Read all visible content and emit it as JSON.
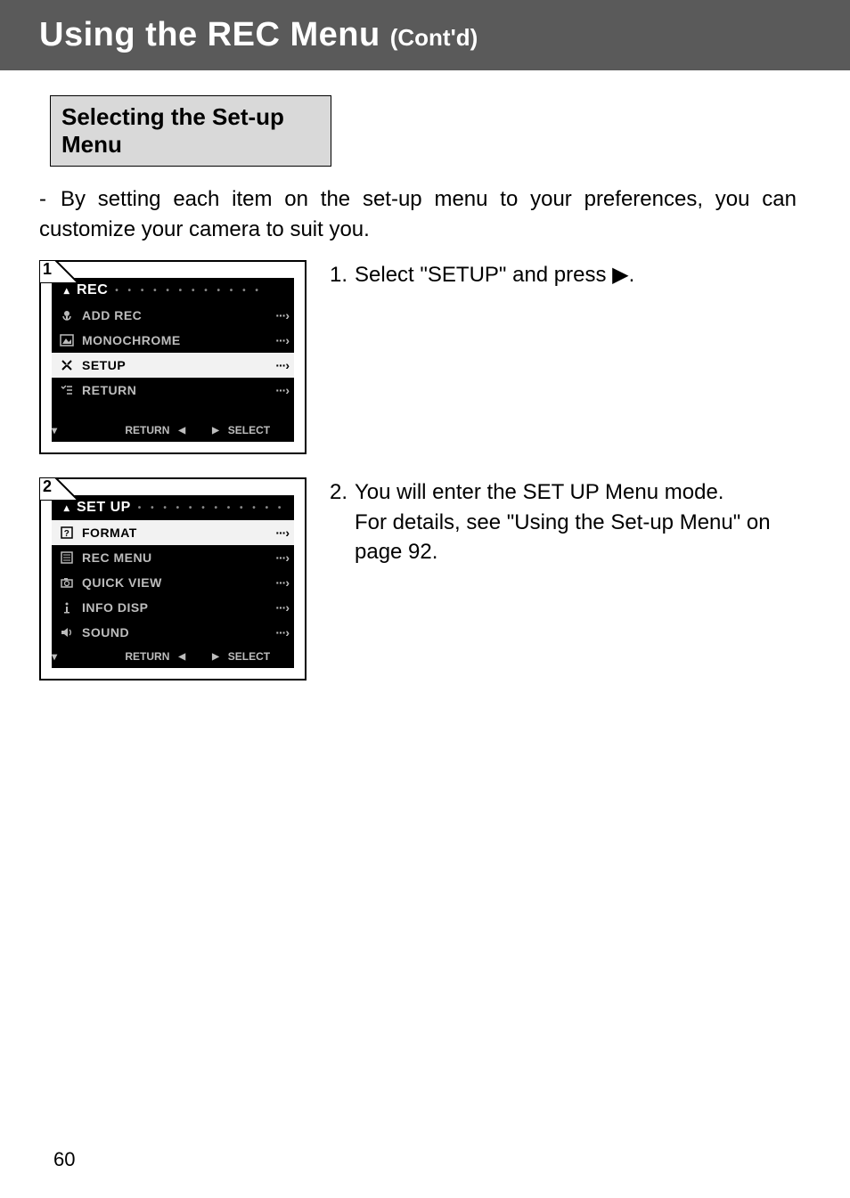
{
  "header": {
    "title_main": "Using the REC Menu ",
    "title_sub": "(Cont'd)"
  },
  "section_heading": "Selecting the Set-up Menu",
  "intro": {
    "dash": "- ",
    "text": "By setting each item on the set-up menu to your preferences, you can customize your camera to suit you."
  },
  "step1": {
    "box_number": "1",
    "text_num": "1.",
    "text": "Select \"SETUP\" and press ▶.",
    "lcd": {
      "header": "REC",
      "items": [
        {
          "label": "ADD REC",
          "selected": false
        },
        {
          "label": "MONOCHROME",
          "selected": false
        },
        {
          "label": "SETUP",
          "selected": true
        },
        {
          "label": "RETURN",
          "selected": false
        }
      ],
      "footer_return": "RETURN",
      "footer_select": "SELECT",
      "arrow_glyph": "···›"
    }
  },
  "step2": {
    "box_number": "2",
    "text_num": "2.",
    "text_line1": "You will enter the SET UP Menu mode.",
    "text_line2": "For details, see \"Using the Set-up Menu\" on page 92.",
    "lcd": {
      "header": "SET UP",
      "items": [
        {
          "label": "FORMAT",
          "selected": true
        },
        {
          "label": "REC MENU",
          "selected": false
        },
        {
          "label": "QUICK VIEW",
          "selected": false
        },
        {
          "label": "INFO DISP",
          "selected": false
        },
        {
          "label": "SOUND",
          "selected": false
        }
      ],
      "footer_return": "RETURN",
      "footer_select": "SELECT",
      "arrow_glyph": "···›"
    }
  },
  "page_number": "60"
}
